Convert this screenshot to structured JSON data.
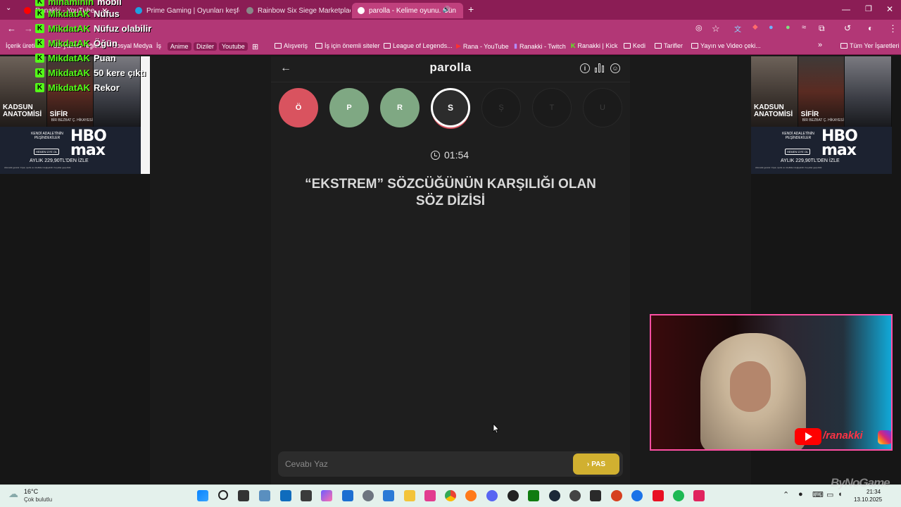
{
  "browser": {
    "tabs": [
      {
        "title": "Ranakki - YouTube",
        "favicon_color": "#ff0000"
      },
      {
        "title": "Prime Gaming | Oyunları keşfet",
        "favicon_color": "#1fa0e0"
      },
      {
        "title": "Rainbow Six Siege Marketplace",
        "favicon_color": "#888888"
      },
      {
        "title": "parolla - Kelime oyunu. Gün",
        "favicon_color": "#ffffff",
        "active": true
      }
    ],
    "new_tab": "+",
    "bookmarks": [
      {
        "label": "İçerik üretici"
      },
      {
        "label": "3D yazılar"
      },
      {
        "label": "eğitim"
      },
      {
        "label": "Sosyal Medya"
      },
      {
        "label": "İş"
      },
      {
        "label": "Anime",
        "pill": true
      },
      {
        "label": "Diziler",
        "pill": true
      },
      {
        "label": "Youtube",
        "pill": true
      },
      {
        "label": "Alışveriş",
        "folder": true
      },
      {
        "label": "İş için önemli siteler",
        "folder": true
      },
      {
        "label": "League of Legends...",
        "folder": true
      },
      {
        "label": "Rana - YouTube"
      },
      {
        "label": "Ranakki - Twitch"
      },
      {
        "label": "Ranakki | Kick"
      },
      {
        "label": "Kedi",
        "folder": true
      },
      {
        "label": "Tarifler",
        "folder": true
      },
      {
        "label": "Yayın ve Video çeki...",
        "folder": true
      }
    ],
    "bookmarks_more": "»",
    "all_bookmarks": "Tüm Yer İşaretleri"
  },
  "chat": [
    {
      "user": "minaminin",
      "message": "mobil"
    },
    {
      "user": "MikdatAK",
      "message": "Nüfus"
    },
    {
      "user": "MikdatAK",
      "message": "Nüfuz olabilir"
    },
    {
      "user": "MikdatAK",
      "message": "Öğün"
    },
    {
      "user": "MikdatAK",
      "message": "Puan"
    },
    {
      "user": "MikdatAK",
      "message": "50 kere çıktı"
    },
    {
      "user": "MikdatAK",
      "message": "Rekor"
    }
  ],
  "ad": {
    "poster1_title": "KADSUN ANATOMİSİ",
    "poster2_title": "SİFİR",
    "poster2_sub": "BİR BEZBAT Ç. HİKAYESİ",
    "tagline": "KENDİ ADALETİNİN PEŞİNDEKİLER",
    "cta": "HEMEN ÜYE OL",
    "brand": "HBO max",
    "price": "AYLIK 229,90TL'DEN İZLE",
    "legal": "Abonelik gerekir. Fiyat, içerik ve özellikler değişebilir. Koşullar geçerlidir."
  },
  "game": {
    "logo": "parolla",
    "letters": [
      {
        "letter": "Ö",
        "state": "wrong"
      },
      {
        "letter": "P",
        "state": "right"
      },
      {
        "letter": "R",
        "state": "right"
      },
      {
        "letter": "S",
        "state": "current"
      },
      {
        "letter": "Ş",
        "state": "pending"
      },
      {
        "letter": "T",
        "state": "pending"
      },
      {
        "letter": "U",
        "state": "pending"
      }
    ],
    "timer": "01:54",
    "question": "“EKSTREM” SÖZCÜĞÜNÜN KARŞILIĞI OLAN SÖZ DİZİSİ",
    "answer_placeholder": "Cevabı Yaz",
    "pass_label": "PAS"
  },
  "webcam": {
    "handle": "/ranakki"
  },
  "taskbar": {
    "temperature": "16°C",
    "weather": "Çok bulutlu",
    "time": "21:34",
    "date": "13.10.2025",
    "watermark": "ByNoGame"
  },
  "colors": {
    "wrong": "#d9535f",
    "right": "#7fa883",
    "pass": "#d1b030",
    "browser_accent": "#b23776"
  }
}
